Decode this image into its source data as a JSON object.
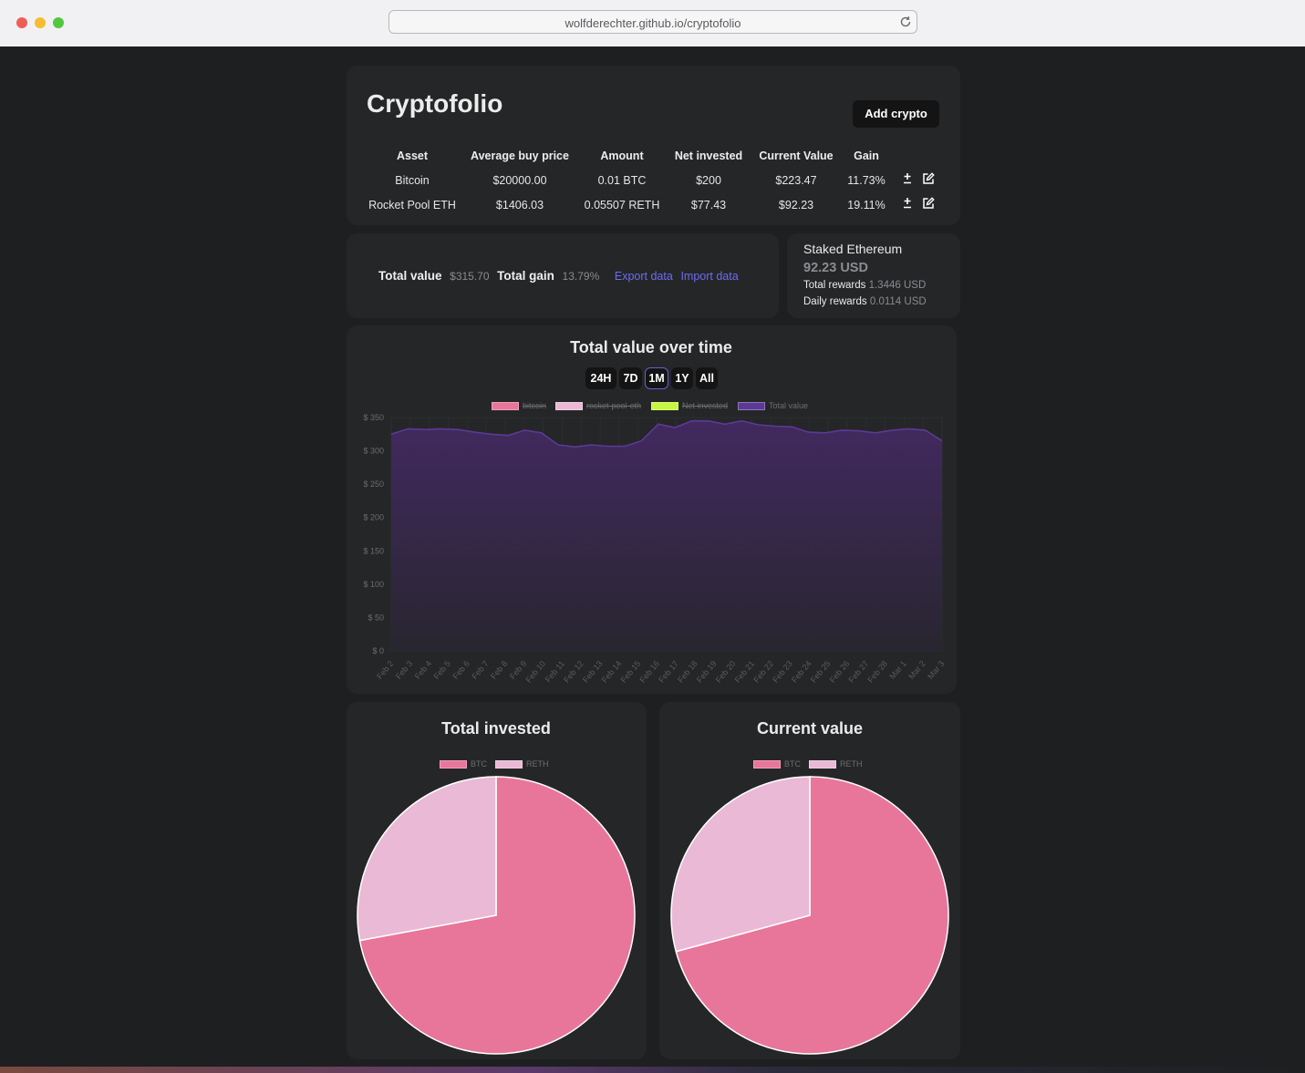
{
  "browser": {
    "url": "wolfderechter.github.io/cryptofolio"
  },
  "header": {
    "title": "Cryptofolio",
    "add_button": "Add crypto"
  },
  "table": {
    "columns": [
      "Asset",
      "Average buy price",
      "Amount",
      "Net invested",
      "Current Value",
      "Gain"
    ],
    "rows": [
      {
        "asset": "Bitcoin",
        "avg_price": "$20000.00",
        "amount": "0.01 BTC",
        "net_invested": "$200",
        "current_value": "$223.47",
        "gain": "11.73%"
      },
      {
        "asset": "Rocket Pool ETH",
        "avg_price": "$1406.03",
        "amount": "0.05507 RETH",
        "net_invested": "$77.43",
        "current_value": "$92.23",
        "gain": "19.11%"
      }
    ],
    "row_icons": [
      "plus-minus-icon",
      "edit-icon"
    ]
  },
  "summary": {
    "total_value_label": "Total value",
    "total_value": "$315.70",
    "total_gain_label": "Total gain",
    "total_gain": "13.79%",
    "export_label": "Export data",
    "import_label": "Import data"
  },
  "staked": {
    "title": "Staked Ethereum",
    "value": "92.23 USD",
    "total_rewards_label": "Total rewards",
    "total_rewards": "1.3446 USD",
    "daily_rewards_label": "Daily rewards",
    "daily_rewards": "0.0114 USD"
  },
  "time_range": {
    "options": [
      "24H",
      "7D",
      "1M",
      "1Y",
      "All"
    ],
    "selected": "1M"
  },
  "colors": {
    "bitcoin": "#e8769a",
    "reth": "#eab9d5",
    "net_invested": "#c8f542",
    "total_value": "#5b3a96",
    "link": "#6b6df0"
  },
  "chart_data": [
    {
      "type": "area",
      "title": "Total value over time",
      "legend": [
        {
          "name": "bitcoin",
          "hidden": true
        },
        {
          "name": "rocket-pool-eth",
          "hidden": true
        },
        {
          "name": "Net invested",
          "hidden": true
        },
        {
          "name": "Total value",
          "hidden": false
        }
      ],
      "x": [
        "Feb 2",
        "Feb 3",
        "Feb 4",
        "Feb 5",
        "Feb 6",
        "Feb 7",
        "Feb 8",
        "Feb 9",
        "Feb 10",
        "Feb 11",
        "Feb 12",
        "Feb 13",
        "Feb 14",
        "Feb 15",
        "Feb 16",
        "Feb 17",
        "Feb 18",
        "Feb 19",
        "Feb 20",
        "Feb 21",
        "Feb 22",
        "Feb 23",
        "Feb 24",
        "Feb 25",
        "Feb 26",
        "Feb 27",
        "Feb 28",
        "Mar 1",
        "Mar 2",
        "Mar 3"
      ],
      "series": [
        {
          "name": "Total value",
          "values": [
            325,
            333,
            332,
            333,
            332,
            328,
            325,
            323,
            331,
            327,
            309,
            306,
            309,
            307,
            307,
            315,
            340,
            335,
            345,
            345,
            340,
            345,
            339,
            337,
            336,
            328,
            327,
            331,
            330,
            327,
            331,
            333,
            331,
            315
          ]
        }
      ],
      "x_points": 34,
      "y_ticks": [
        "$ 0",
        "$ 50",
        "$ 100",
        "$ 150",
        "$ 200",
        "$ 250",
        "$ 300",
        "$ 350"
      ],
      "ylim": [
        0,
        350
      ],
      "grid": true
    },
    {
      "type": "pie",
      "title": "Total invested",
      "legend": [
        "BTC",
        "RETH"
      ],
      "values": [
        200,
        77.43
      ]
    },
    {
      "type": "pie",
      "title": "Current value",
      "legend": [
        "BTC",
        "RETH"
      ],
      "values": [
        223.47,
        92.23
      ]
    }
  ]
}
